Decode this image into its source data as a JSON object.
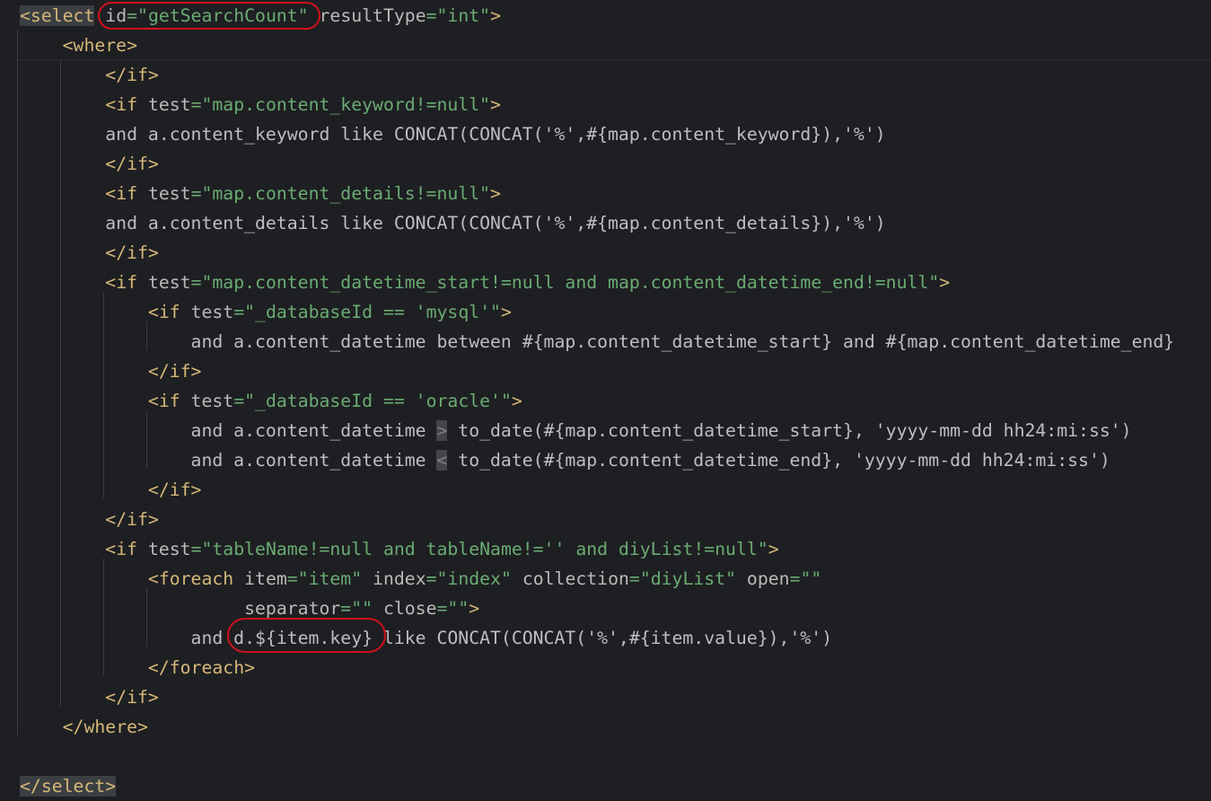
{
  "colors": {
    "background": "#1e1f22",
    "tag": "#d5b778",
    "attribute": "#bababa",
    "string": "#6aab73",
    "text": "#bcbec4",
    "annotation": "#d0121b"
  },
  "lines": [
    [
      {
        "t": "<select",
        "c": "tag",
        "h": true
      },
      {
        "t": " ",
        "c": "txt"
      },
      {
        "t": "id",
        "c": "attr"
      },
      {
        "t": "=\"getSearchCount\"",
        "c": "str"
      },
      {
        "t": " ",
        "c": "txt"
      },
      {
        "t": "resultType",
        "c": "attr"
      },
      {
        "t": "=\"int\"",
        "c": "str"
      },
      {
        "t": ">",
        "c": "tag"
      }
    ],
    [
      {
        "t": "    ",
        "c": "txt"
      },
      {
        "t": "<where>",
        "c": "tag"
      }
    ],
    [
      {
        "t": "        ",
        "c": "txt"
      },
      {
        "t": "</if>",
        "c": "tag"
      }
    ],
    [
      {
        "t": "        ",
        "c": "txt"
      },
      {
        "t": "<if",
        "c": "tag"
      },
      {
        "t": " ",
        "c": "txt"
      },
      {
        "t": "test",
        "c": "attr"
      },
      {
        "t": "=\"map.content_keyword!=null\"",
        "c": "str"
      },
      {
        "t": ">",
        "c": "tag"
      }
    ],
    [
      {
        "t": "        and a.content_keyword like CONCAT(CONCAT('%',#{map.content_keyword}),'%')",
        "c": "txt"
      }
    ],
    [
      {
        "t": "        ",
        "c": "txt"
      },
      {
        "t": "</if>",
        "c": "tag"
      }
    ],
    [
      {
        "t": "        ",
        "c": "txt"
      },
      {
        "t": "<if",
        "c": "tag"
      },
      {
        "t": " ",
        "c": "txt"
      },
      {
        "t": "test",
        "c": "attr"
      },
      {
        "t": "=\"map.content_details!=null\"",
        "c": "str"
      },
      {
        "t": ">",
        "c": "tag"
      }
    ],
    [
      {
        "t": "        and a.content_details like CONCAT(CONCAT('%',#{map.content_details}),'%')",
        "c": "txt"
      }
    ],
    [
      {
        "t": "        ",
        "c": "txt"
      },
      {
        "t": "</if>",
        "c": "tag"
      }
    ],
    [
      {
        "t": "        ",
        "c": "txt"
      },
      {
        "t": "<if",
        "c": "tag"
      },
      {
        "t": " ",
        "c": "txt"
      },
      {
        "t": "test",
        "c": "attr"
      },
      {
        "t": "=\"map.content_datetime_start!=null and map.content_datetime_end!=null\"",
        "c": "str"
      },
      {
        "t": ">",
        "c": "tag"
      }
    ],
    [
      {
        "t": "            ",
        "c": "txt"
      },
      {
        "t": "<if",
        "c": "tag"
      },
      {
        "t": " ",
        "c": "txt"
      },
      {
        "t": "test",
        "c": "attr"
      },
      {
        "t": "=\"_databaseId == 'mysql'\"",
        "c": "str"
      },
      {
        "t": ">",
        "c": "tag"
      }
    ],
    [
      {
        "t": "                and a.content_datetime between #{map.content_datetime_start} and #{map.content_datetime_end}",
        "c": "txt"
      }
    ],
    [
      {
        "t": "            ",
        "c": "txt"
      },
      {
        "t": "</if>",
        "c": "tag"
      }
    ],
    [
      {
        "t": "            ",
        "c": "txt"
      },
      {
        "t": "<if",
        "c": "tag"
      },
      {
        "t": " ",
        "c": "txt"
      },
      {
        "t": "test",
        "c": "attr"
      },
      {
        "t": "=\"_databaseId == 'oracle'\"",
        "c": "str"
      },
      {
        "t": ">",
        "c": "tag"
      }
    ],
    [
      {
        "t": "                and a.content_datetime ",
        "c": "txt"
      },
      {
        "t": ">",
        "c": "ent"
      },
      {
        "t": " to_date(#{map.content_datetime_start}, 'yyyy-mm-dd hh24:mi:ss')",
        "c": "txt"
      }
    ],
    [
      {
        "t": "                and a.content_datetime ",
        "c": "txt"
      },
      {
        "t": "<",
        "c": "ent"
      },
      {
        "t": " to_date(#{map.content_datetime_end}, 'yyyy-mm-dd hh24:mi:ss')",
        "c": "txt"
      }
    ],
    [
      {
        "t": "            ",
        "c": "txt"
      },
      {
        "t": "</if>",
        "c": "tag"
      }
    ],
    [
      {
        "t": "        ",
        "c": "txt"
      },
      {
        "t": "</if>",
        "c": "tag"
      }
    ],
    [
      {
        "t": "        ",
        "c": "txt"
      },
      {
        "t": "<if",
        "c": "tag"
      },
      {
        "t": " ",
        "c": "txt"
      },
      {
        "t": "test",
        "c": "attr"
      },
      {
        "t": "=\"tableName!=null and tableName!='' and diyList!=null\"",
        "c": "str"
      },
      {
        "t": ">",
        "c": "tag"
      }
    ],
    [
      {
        "t": "            ",
        "c": "txt"
      },
      {
        "t": "<foreach",
        "c": "tag"
      },
      {
        "t": " ",
        "c": "txt"
      },
      {
        "t": "item",
        "c": "attr"
      },
      {
        "t": "=\"item\"",
        "c": "str"
      },
      {
        "t": " ",
        "c": "txt"
      },
      {
        "t": "index",
        "c": "attr"
      },
      {
        "t": "=\"index\"",
        "c": "str"
      },
      {
        "t": " ",
        "c": "txt"
      },
      {
        "t": "collection",
        "c": "attr"
      },
      {
        "t": "=\"diyList\"",
        "c": "str"
      },
      {
        "t": " ",
        "c": "txt"
      },
      {
        "t": "open",
        "c": "attr"
      },
      {
        "t": "=\"\"",
        "c": "str"
      }
    ],
    [
      {
        "t": "                     ",
        "c": "txt"
      },
      {
        "t": "separator",
        "c": "attr"
      },
      {
        "t": "=\"\"",
        "c": "str"
      },
      {
        "t": " ",
        "c": "txt"
      },
      {
        "t": "close",
        "c": "attr"
      },
      {
        "t": "=\"\"",
        "c": "str"
      },
      {
        "t": ">",
        "c": "tag"
      }
    ],
    [
      {
        "t": "                and d.${item.key} like CONCAT(CONCAT('%',#{item.value}),'%')",
        "c": "txt"
      }
    ],
    [
      {
        "t": "            ",
        "c": "txt"
      },
      {
        "t": "</foreach>",
        "c": "tag"
      }
    ],
    [
      {
        "t": "        ",
        "c": "txt"
      },
      {
        "t": "</if>",
        "c": "tag"
      }
    ],
    [
      {
        "t": "    ",
        "c": "txt"
      },
      {
        "t": "</where>",
        "c": "tag"
      }
    ],
    [
      {
        "t": "",
        "c": "txt"
      }
    ],
    [
      {
        "t": "</select>",
        "c": "tag",
        "h": true
      }
    ]
  ]
}
